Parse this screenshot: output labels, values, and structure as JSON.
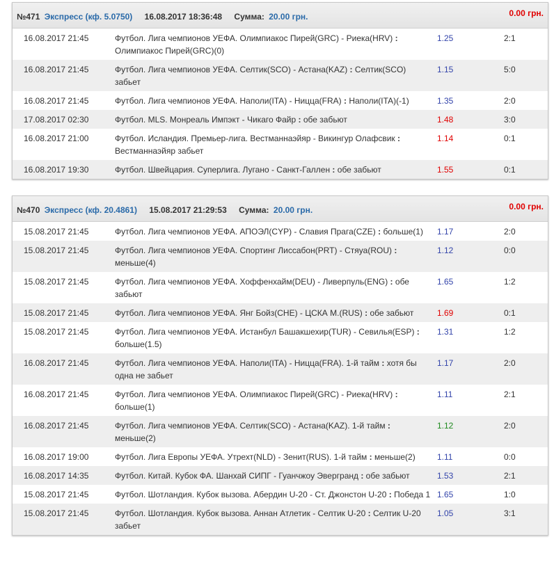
{
  "bets": [
    {
      "number": "№471",
      "type": "Экспресс (кф. 5.0750)",
      "datetime": "16.08.2017 18:36:48",
      "sum_label": "Сумма:",
      "sum": "20.00 грн.",
      "win": "0.00 грн.",
      "rows": [
        {
          "date": "16.08.2017 21:45",
          "event": "Футбол. Лига чемпионов УЕФА. Олимпиакос Пирей(GRC) - Риека(HRV)",
          "bet": "Олимпиакос Пирей(GRC)(0)",
          "coef": "1.25",
          "score": "2:1",
          "color": "blue"
        },
        {
          "date": "16.08.2017 21:45",
          "event": "Футбол. Лига чемпионов УЕФА. Селтик(SCO) - Астана(KAZ)",
          "bet": "Селтик(SCO) забьет",
          "coef": "1.15",
          "score": "5:0",
          "color": "blue"
        },
        {
          "date": "16.08.2017 21:45",
          "event": "Футбол. Лига чемпионов УЕФА. Наполи(ITA) - Ницца(FRA)",
          "bet": "Наполи(ITA)(-1)",
          "coef": "1.35",
          "score": "2:0",
          "color": "blue"
        },
        {
          "date": "17.08.2017 02:30",
          "event": "Футбол. MLS. Монреаль Импэкт - Чикаго Файр",
          "bet": "обе забьют",
          "coef": "1.48",
          "score": "3:0",
          "color": "red"
        },
        {
          "date": "16.08.2017 21:00",
          "event": "Футбол. Исландия. Премьер-лига. Вестманнаэйяр - Викингур Олафсвик",
          "bet": "Вестманнаэйяр забьет",
          "coef": "1.14",
          "score": "0:1",
          "color": "red"
        },
        {
          "date": "16.08.2017 19:30",
          "event": "Футбол. Швейцария. Суперлига. Лугано - Санкт-Галлен",
          "bet": "обе забьют",
          "coef": "1.55",
          "score": "0:1",
          "color": "red"
        }
      ]
    },
    {
      "number": "№470",
      "type": "Экспресс (кф. 20.4861)",
      "datetime": "15.08.2017 21:29:53",
      "sum_label": "Сумма:",
      "sum": "20.00 грн.",
      "win": "0.00 грн.",
      "rows": [
        {
          "date": "15.08.2017 21:45",
          "event": "Футбол. Лига чемпионов УЕФА. АПОЭЛ(CYP) - Славия Прага(CZE)",
          "bet": "больше(1)",
          "coef": "1.17",
          "score": "2:0",
          "color": "blue"
        },
        {
          "date": "15.08.2017 21:45",
          "event": "Футбол. Лига чемпионов УЕФА. Спортинг Лиссабон(PRT) - Стяуа(ROU)",
          "bet": "меньше(4)",
          "coef": "1.12",
          "score": "0:0",
          "color": "blue"
        },
        {
          "date": "15.08.2017 21:45",
          "event": "Футбол. Лига чемпионов УЕФА. Хоффенхайм(DEU) - Ливерпуль(ENG)",
          "bet": "обе забьют",
          "coef": "1.65",
          "score": "1:2",
          "color": "blue"
        },
        {
          "date": "15.08.2017 21:45",
          "event": "Футбол. Лига чемпионов УЕФА. Янг Бойз(CHE) - ЦСКА М.(RUS)",
          "bet": "обе забьют",
          "coef": "1.69",
          "score": "0:1",
          "color": "red"
        },
        {
          "date": "15.08.2017 21:45",
          "event": "Футбол. Лига чемпионов УЕФА. Истанбул Башакшехир(TUR) - Севилья(ESP)",
          "bet": "больше(1.5)",
          "coef": "1.31",
          "score": "1:2",
          "color": "blue"
        },
        {
          "date": "16.08.2017 21:45",
          "event": "Футбол. Лига чемпионов УЕФА. Наполи(ITA) - Ницца(FRA). 1-й тайм",
          "bet": "хотя бы одна не забьет",
          "coef": "1.17",
          "score": "2:0",
          "color": "blue"
        },
        {
          "date": "16.08.2017 21:45",
          "event": "Футбол. Лига чемпионов УЕФА. Олимпиакос Пирей(GRC) - Риека(HRV)",
          "bet": "больше(1)",
          "coef": "1.11",
          "score": "2:1",
          "color": "blue"
        },
        {
          "date": "16.08.2017 21:45",
          "event": "Футбол. Лига чемпионов УЕФА. Селтик(SCO) - Астана(KAZ). 1-й тайм",
          "bet": "меньше(2)",
          "coef": "1.12",
          "score": "2:0",
          "color": "green"
        },
        {
          "date": "16.08.2017 19:00",
          "event": "Футбол. Лига Европы УЕФА. Утрехт(NLD) - Зенит(RUS). 1-й тайм",
          "bet": "меньше(2)",
          "coef": "1.11",
          "score": "0:0",
          "color": "blue"
        },
        {
          "date": "16.08.2017 14:35",
          "event": "Футбол. Китай. Кубок ФА. Шанхай СИПГ - Гуанчжоу Эвергранд",
          "bet": "обе забьют",
          "coef": "1.53",
          "score": "2:1",
          "color": "blue"
        },
        {
          "date": "15.08.2017 21:45",
          "event": "Футбол. Шотландия. Кубок вызова. Абердин U-20 - Ст. Джонстон U-20",
          "bet": "Победа 1",
          "coef": "1.65",
          "score": "1:0",
          "color": "blue"
        },
        {
          "date": "15.08.2017 21:45",
          "event": "Футбол. Шотландия. Кубок вызова. Аннан Атлетик - Селтик U-20",
          "bet": "Селтик U-20 забьет",
          "coef": "1.05",
          "score": "3:1",
          "color": "blue"
        }
      ]
    }
  ]
}
